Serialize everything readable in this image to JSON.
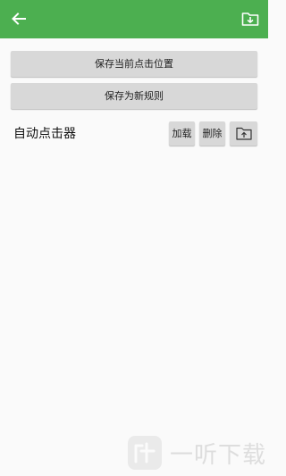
{
  "colors": {
    "toolbar": "#4caf50",
    "button": "#d8d8d8",
    "background": "#fafafa"
  },
  "toolbar": {
    "back_icon": "arrow-left-icon",
    "import_icon": "folder-download-icon"
  },
  "actions": {
    "save_position_label": "保存当前点击位置",
    "save_rule_label": "保存为新规则"
  },
  "rule": {
    "name": "自动点击器",
    "load_label": "加载",
    "delete_label": "删除",
    "upload_icon": "folder-upload-icon"
  },
  "watermark": {
    "text": "一听下载"
  }
}
